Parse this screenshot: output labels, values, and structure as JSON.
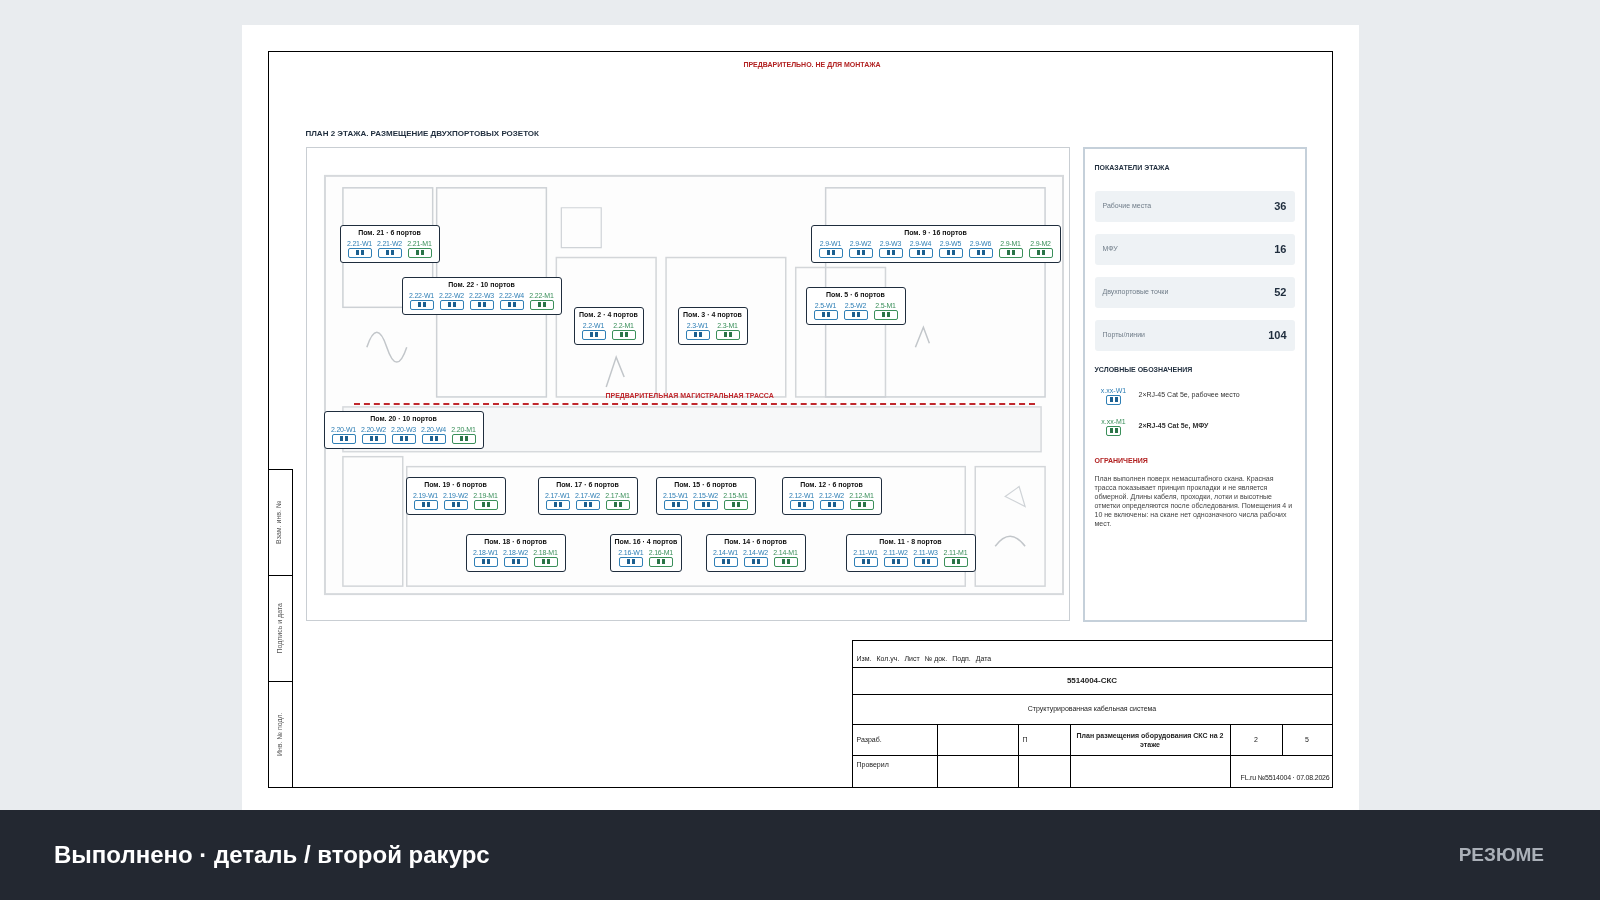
{
  "notice": "ПРЕДВАРИТЕЛЬНО. НЕ ДЛЯ МОНТАЖА",
  "plan": {
    "title": "ПЛАН 2 ЭТАЖА. РАЗМЕЩЕНИЕ ДВУХПОРТОВЫХ РОЗЕТОК",
    "route_label": "ПРЕДВАРИТЕЛЬНАЯ МАГИСТРАЛЬНАЯ ТРАССА",
    "rooms": [
      {
        "title": "Пом. 21 · 6 портов",
        "sockets": [
          {
            "label": "2.21-W1",
            "kind": "workplace"
          },
          {
            "label": "2.21-W2",
            "kind": "workplace"
          },
          {
            "label": "2.21-M1",
            "kind": "mfp"
          }
        ]
      },
      {
        "title": "Пом. 22 · 10 портов",
        "sockets": [
          {
            "label": "2.22-W1",
            "kind": "workplace"
          },
          {
            "label": "2.22-W2",
            "kind": "workplace"
          },
          {
            "label": "2.22-W3",
            "kind": "workplace"
          },
          {
            "label": "2.22-W4",
            "kind": "workplace"
          },
          {
            "label": "2.22-M1",
            "kind": "mfp"
          }
        ]
      },
      {
        "title": "Пом. 2 · 4 портов",
        "sockets": [
          {
            "label": "2.2-W1",
            "kind": "workplace"
          },
          {
            "label": "2.2-M1",
            "kind": "mfp"
          }
        ]
      },
      {
        "title": "Пом. 3 · 4 портов",
        "sockets": [
          {
            "label": "2.3-W1",
            "kind": "workplace"
          },
          {
            "label": "2.3-M1",
            "kind": "mfp"
          }
        ]
      },
      {
        "title": "Пом. 9 · 16 портов",
        "sockets": [
          {
            "label": "2.9-W1",
            "kind": "workplace"
          },
          {
            "label": "2.9-W2",
            "kind": "workplace"
          },
          {
            "label": "2.9-W3",
            "kind": "workplace"
          },
          {
            "label": "2.9-W4",
            "kind": "workplace"
          },
          {
            "label": "2.9-W5",
            "kind": "workplace"
          },
          {
            "label": "2.9-W6",
            "kind": "workplace"
          },
          {
            "label": "2.9-M1",
            "kind": "mfp"
          },
          {
            "label": "2.9-M2",
            "kind": "mfp"
          }
        ]
      },
      {
        "title": "Пом. 5 · 6 портов",
        "sockets": [
          {
            "label": "2.5-W1",
            "kind": "workplace"
          },
          {
            "label": "2.5-W2",
            "kind": "workplace"
          },
          {
            "label": "2.5-M1",
            "kind": "mfp"
          }
        ]
      },
      {
        "title": "Пом. 20 · 10 портов",
        "sockets": [
          {
            "label": "2.20-W1",
            "kind": "workplace"
          },
          {
            "label": "2.20-W2",
            "kind": "workplace"
          },
          {
            "label": "2.20-W3",
            "kind": "workplace"
          },
          {
            "label": "2.20-W4",
            "kind": "workplace"
          },
          {
            "label": "2.20-M1",
            "kind": "mfp"
          }
        ]
      },
      {
        "title": "Пом. 19 · 6 портов",
        "sockets": [
          {
            "label": "2.19-W1",
            "kind": "workplace"
          },
          {
            "label": "2.19-W2",
            "kind": "workplace"
          },
          {
            "label": "2.19-M1",
            "kind": "mfp"
          }
        ]
      },
      {
        "title": "Пом. 18 · 6 портов",
        "sockets": [
          {
            "label": "2.18-W1",
            "kind": "workplace"
          },
          {
            "label": "2.18-W2",
            "kind": "workplace"
          },
          {
            "label": "2.18-M1",
            "kind": "mfp"
          }
        ]
      },
      {
        "title": "Пом. 17 · 6 портов",
        "sockets": [
          {
            "label": "2.17-W1",
            "kind": "workplace"
          },
          {
            "label": "2.17-W2",
            "kind": "workplace"
          },
          {
            "label": "2.17-M1",
            "kind": "mfp"
          }
        ]
      },
      {
        "title": "Пом. 16 · 4 портов",
        "sockets": [
          {
            "label": "2.16-W1",
            "kind": "workplace"
          },
          {
            "label": "2.16-M1",
            "kind": "mfp"
          }
        ]
      },
      {
        "title": "Пом. 15 · 6 портов",
        "sockets": [
          {
            "label": "2.15-W1",
            "kind": "workplace"
          },
          {
            "label": "2.15-W2",
            "kind": "workplace"
          },
          {
            "label": "2.15-M1",
            "kind": "mfp"
          }
        ]
      },
      {
        "title": "Пом. 14 · 6 портов",
        "sockets": [
          {
            "label": "2.14-W1",
            "kind": "workplace"
          },
          {
            "label": "2.14-W2",
            "kind": "workplace"
          },
          {
            "label": "2.14-M1",
            "kind": "mfp"
          }
        ]
      },
      {
        "title": "Пом. 12 · 6 портов",
        "sockets": [
          {
            "label": "2.12-W1",
            "kind": "workplace"
          },
          {
            "label": "2.12-W2",
            "kind": "workplace"
          },
          {
            "label": "2.12-M1",
            "kind": "mfp"
          }
        ]
      },
      {
        "title": "Пом. 11 · 8 портов",
        "sockets": [
          {
            "label": "2.11-W1",
            "kind": "workplace"
          },
          {
            "label": "2.11-W2",
            "kind": "workplace"
          },
          {
            "label": "2.11-W3",
            "kind": "workplace"
          },
          {
            "label": "2.11-M1",
            "kind": "mfp"
          }
        ]
      }
    ]
  },
  "panel": {
    "title": "ПОКАЗАТЕЛИ ЭТАЖА",
    "stats": [
      {
        "label": "Рабочие места",
        "value": "36"
      },
      {
        "label": "МФУ",
        "value": "16"
      },
      {
        "label": "Двухпортовые точки",
        "value": "52"
      },
      {
        "label": "Порты/линии",
        "value": "104"
      }
    ],
    "legend_title": "УСЛОВНЫЕ ОБОЗНАЧЕНИЯ",
    "legend": [
      {
        "code": "x.xx-W1",
        "kind": "workplace",
        "text": "2×RJ-45 Cat 5e, рабочее место",
        "bold": false
      },
      {
        "code": "x.xx-M1",
        "kind": "mfp",
        "text": "2×RJ-45 Cat 5e, МФУ",
        "bold": true
      }
    ],
    "limits_title": "ОГРАНИЧЕНИЯ",
    "limits_text": "План выполнен поверх немасштабного скана. Красная трасса показывает принцип прокладки и не является обмерной. Длины кабеля, проходки, лотки и высотные отметки определяются после обследования. Помещения 4 и 10 не включены: на скане нет однозначного числа рабочих мест."
  },
  "stamp": {
    "side_cells": [
      "Взам. инв. №",
      "Подпись и дата",
      "Инв. № подл."
    ],
    "header": [
      "Изм.",
      "Кол.уч.",
      "Лист",
      "№ док.",
      "Подп.",
      "Дата"
    ],
    "code": "5514004-СКС",
    "system": "Структурированная кабельная система",
    "developer_label": "Разраб.",
    "stage": "П",
    "sheet_title": "План размещения оборудования СКС на 2 этаже",
    "sheet": "2",
    "sheets": "5",
    "checker_label": "Проверил",
    "reference": "FL.ru №5514004 · 07.08.2026"
  },
  "footer": {
    "caption": "Выполнено · деталь / второй ракурс",
    "link": "РЕЗЮМЕ"
  }
}
